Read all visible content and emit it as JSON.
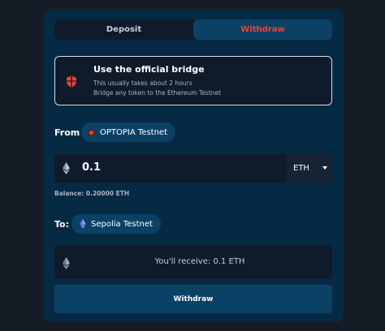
{
  "tabs": [
    {
      "label": "Deposit",
      "active": false
    },
    {
      "label": "Withdraw",
      "active": true
    }
  ],
  "bridge": {
    "title": "Use the official bridge",
    "line1": "This usually takes about 2 hours",
    "line2": "Bridge any token to the Ethereum Testnet",
    "icon": "shield-icon"
  },
  "from": {
    "label": "From",
    "network": "OPTOPIA Testnet"
  },
  "amount": {
    "value": "0.1",
    "token": "ETH"
  },
  "balance": "Balance: 0.20000 ETH",
  "to": {
    "label": "To:",
    "network": "Sepolia Testnet"
  },
  "receive": "You'll receive: 0.1 ETH",
  "submit_label": "Withdraw",
  "colors": {
    "background": "#161c26",
    "panel": "#062944",
    "accent": "#0c4166",
    "active_tab_text": "#e8443a",
    "optopia_red": "#e8443a",
    "eth_blue": "#627eea"
  }
}
